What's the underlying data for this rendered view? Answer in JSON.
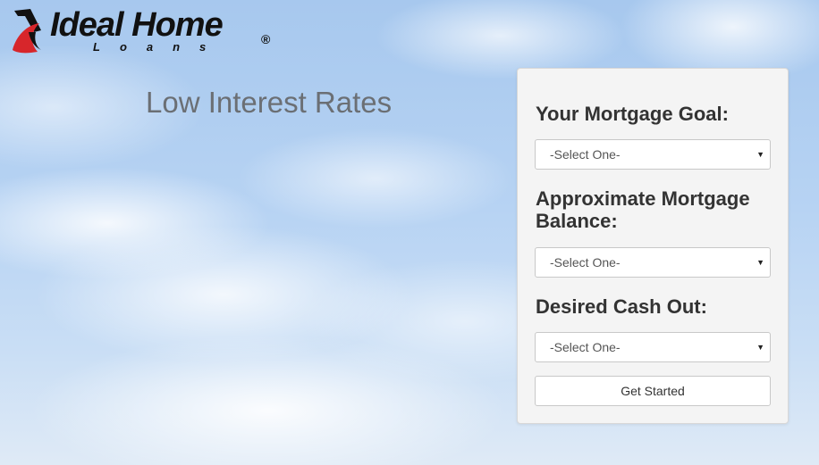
{
  "logo": {
    "name": "Ideal Home",
    "sub": "Loans",
    "registered": "®",
    "icon": "swoosh-logo-icon",
    "colors": {
      "black": "#111111",
      "red": "#d7262b"
    }
  },
  "hero": {
    "tagline": "Low Interest Rates"
  },
  "form": {
    "goal_label": "Your Mortgage Goal:",
    "goal_value": "-Select One-",
    "balance_label": "Approximate Mortgage Balance:",
    "balance_value": "-Select One-",
    "cash_label": "Desired Cash Out:",
    "cash_value": "-Select One-",
    "submit_label": "Get Started",
    "caret_icon": "triangle-down-icon"
  }
}
